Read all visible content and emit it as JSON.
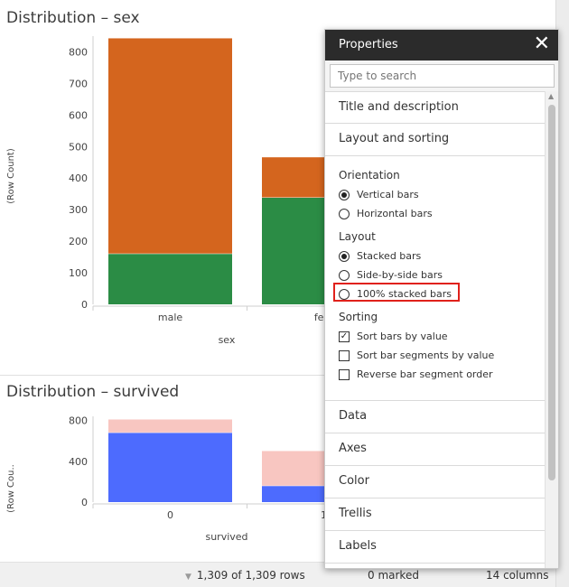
{
  "charts": [
    {
      "title": "Distribution – sex",
      "chart_data": {
        "type": "bar",
        "stacked": true,
        "categories": [
          "male",
          "female"
        ],
        "series": [
          {
            "values": [
              161,
              339
            ],
            "color": "#2b8c45"
          },
          {
            "values": [
              682,
              127
            ],
            "color": "#d4651e"
          }
        ],
        "xlabel": "sex",
        "ylabel": "(Row Count)",
        "ylim": [
          0,
          850
        ],
        "yticks": [
          0,
          100,
          200,
          300,
          400,
          500,
          600,
          700,
          800
        ],
        "tick_labels": [
          "0",
          "100",
          "200",
          "300",
          "400",
          "500",
          "600",
          "700",
          "800"
        ],
        "category_labels": [
          "male",
          "fem"
        ]
      }
    },
    {
      "title": "Distribution – survived",
      "chart_data": {
        "type": "bar",
        "stacked": true,
        "categories": [
          "0",
          "1"
        ],
        "series": [
          {
            "values": [
              682,
              161
            ],
            "color": "#4d6bfe"
          },
          {
            "values": [
              127,
              339
            ],
            "color": "#f8c6c1"
          }
        ],
        "xlabel": "survived",
        "ylabel": "(Row Cou..",
        "ylim": [
          0,
          840
        ],
        "yticks": [
          0,
          400,
          800
        ],
        "tick_labels": [
          "0",
          "400",
          "800"
        ],
        "category_labels": [
          "0",
          "1"
        ]
      }
    }
  ],
  "status": {
    "rows": "1,309 of 1,309 rows",
    "marked": "0 marked",
    "columns": "14 columns"
  },
  "properties": {
    "title": "Properties",
    "close": "✕",
    "search_placeholder": "Type to search",
    "sections_top": [
      "Title and description",
      "Layout and sorting"
    ],
    "orientation_label": "Orientation",
    "orientation_options": [
      "Vertical bars",
      "Horizontal bars"
    ],
    "layout_label": "Layout",
    "layout_options": [
      "Stacked bars",
      "Side-by-side bars",
      "100% stacked bars"
    ],
    "sorting_label": "Sorting",
    "sorting_options": [
      "Sort bars by value",
      "Sort bar segments by value",
      "Reverse bar segment order"
    ],
    "check_mark": "✓",
    "sections_bottom": [
      "Data",
      "Axes",
      "Color",
      "Trellis",
      "Labels"
    ]
  }
}
